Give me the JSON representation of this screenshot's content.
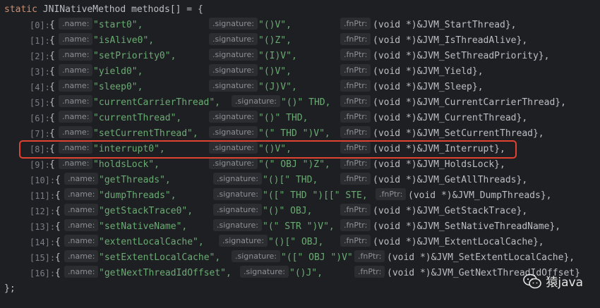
{
  "header": {
    "keyword": "static",
    "type": "JNINativeMethod",
    "decl": "methods[] = {"
  },
  "footer": "};",
  "hints": {
    "name": ".name:",
    "signature": ".signature:",
    "fnptr": ".fnPtr:"
  },
  "rows": [
    {
      "idx": "[0]:",
      "name": "\"start0\",",
      "sig": "\"()V\",",
      "fn": "(void *)&JVM_StartThread},"
    },
    {
      "idx": "[1]:",
      "name": "\"isAlive0\",",
      "sig": "\"()Z\",",
      "fn": "(void *)&JVM_IsThreadAlive},"
    },
    {
      "idx": "[2]:",
      "name": "\"setPriority0\",",
      "sig": "\"(I)V\",",
      "fn": "(void *)&JVM_SetThreadPriority},"
    },
    {
      "idx": "[3]:",
      "name": "\"yield0\",",
      "sig": "\"()V\",",
      "fn": "(void *)&JVM_Yield},"
    },
    {
      "idx": "[4]:",
      "name": "\"sleep0\",",
      "sig": "\"(J)V\",",
      "fn": "(void *)&JVM_Sleep},"
    },
    {
      "idx": "[5]:",
      "name": "\"currentCarrierThread\",",
      "sig": "\"()\" THD,",
      "fn": "(void *)&JVM_CurrentCarrierThread},"
    },
    {
      "idx": "[6]:",
      "name": "\"currentThread\",",
      "sig": "\"()\" THD,",
      "fn": "(void *)&JVM_CurrentThread},"
    },
    {
      "idx": "[7]:",
      "name": "\"setCurrentThread\",",
      "sig": "\"(\" THD \")V\",",
      "fn": "(void *)&JVM_SetCurrentThread},"
    },
    {
      "idx": "[8]:",
      "name": "\"interrupt0\",",
      "sig": "\"()V\",",
      "fn": "(void *)&JVM_Interrupt},"
    },
    {
      "idx": "[9]:",
      "name": "\"holdsLock\",",
      "sig": "\"(\" OBJ \")Z\",",
      "fn": "(void *)&JVM_HoldsLock},"
    },
    {
      "idx": "[10]:",
      "name": "\"getThreads\",",
      "sig": "\"()[\" THD,",
      "fn": "(void *)&JVM_GetAllThreads},"
    },
    {
      "idx": "[11]:",
      "name": "\"dumpThreads\",",
      "sig": "\"([\" THD \")[[\" STE,",
      "fn": "(void *)&JVM_DumpThreads},"
    },
    {
      "idx": "[12]:",
      "name": "\"getStackTrace0\",",
      "sig": "\"()\" OBJ,",
      "fn": "(void *)&JVM_GetStackTrace},"
    },
    {
      "idx": "[13]:",
      "name": "\"setNativeName\",",
      "sig": "\"(\" STR \")V\",",
      "fn": "(void *)&JVM_SetNativeThreadName},"
    },
    {
      "idx": "[14]:",
      "name": "\"extentLocalCache\",",
      "sig": "\"()[\" OBJ,",
      "fn": "(void *)&JVM_ExtentLocalCache},"
    },
    {
      "idx": "[15]:",
      "name": "\"setExtentLocalCache\",",
      "sig": "\"([\" OBJ \")V\",",
      "fn": "(void *)&JVM_SetExtentLocalCache},"
    },
    {
      "idx": "[16]:",
      "name": "\"getNextThreadIdOffset\",",
      "sig": "\"()J\",",
      "fn": "(void *)&JVM_GetNextThreadIdOffset}"
    }
  ],
  "watermark": {
    "text": "猿java",
    "icon": "wechat-icon"
  },
  "colors": {
    "background": "#1e1f22",
    "keyword": "#cf8e6d",
    "string": "#6aab73",
    "highlight": "#e0432f"
  }
}
